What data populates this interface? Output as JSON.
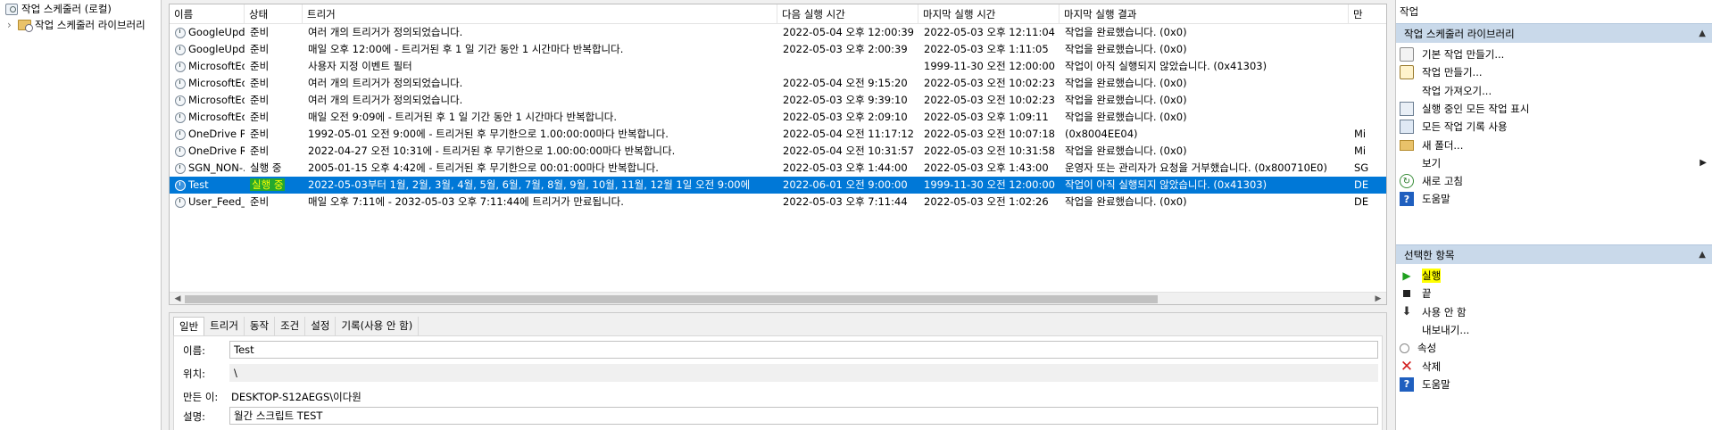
{
  "tree": {
    "root_label": "작업 스케줄러 (로컬)",
    "library_label": "작업 스케줄러 라이브러리"
  },
  "columns": {
    "name": "이름",
    "status": "상태",
    "triggers": "트리거",
    "next_run": "다음 실행 시간",
    "last_run": "마지막 실행 시간",
    "last_result": "마지막 실행 결과",
    "author": "만"
  },
  "tasks": [
    {
      "name": "GoogleUpda...",
      "status": "준비",
      "trigger": "여러 개의 트리거가 정의되었습니다.",
      "next": "2022-05-04 오후 12:00:39",
      "last": "2022-05-03 오후 12:11:04",
      "result": "작업을 완료했습니다. (0x0)",
      "author": ""
    },
    {
      "name": "GoogleUpda...",
      "status": "준비",
      "trigger": "매일 오후 12:00에 - 트리거된 후 1 일 기간 동안 1 시간마다 반복합니다.",
      "next": "2022-05-03 오후 2:00:39",
      "last": "2022-05-03 오후 1:11:05",
      "result": "작업을 완료했습니다. (0x0)",
      "author": ""
    },
    {
      "name": "MicrosoftEd...",
      "status": "준비",
      "trigger": "사용자 지정 이벤트 필터",
      "next": "",
      "last": "1999-11-30 오전 12:00:00",
      "result": "작업이 아직 실행되지 않았습니다. (0x41303)",
      "author": ""
    },
    {
      "name": "MicrosoftEd...",
      "status": "준비",
      "trigger": "여러 개의 트리거가 정의되었습니다.",
      "next": "2022-05-04 오전 9:15:20",
      "last": "2022-05-03 오전 10:02:23",
      "result": "작업을 완료했습니다. (0x0)",
      "author": ""
    },
    {
      "name": "MicrosoftEd...",
      "status": "준비",
      "trigger": "여러 개의 트리거가 정의되었습니다.",
      "next": "2022-05-03 오후 9:39:10",
      "last": "2022-05-03 오전 10:02:23",
      "result": "작업을 완료했습니다. (0x0)",
      "author": ""
    },
    {
      "name": "MicrosoftEd...",
      "status": "준비",
      "trigger": "매일 오전 9:09에 - 트리거된 후 1 일 기간 동안 1 시간마다 반복합니다.",
      "next": "2022-05-03 오후 2:09:10",
      "last": "2022-05-03 오후 1:09:11",
      "result": "작업을 완료했습니다. (0x0)",
      "author": ""
    },
    {
      "name": "OneDrive Pe...",
      "status": "준비",
      "trigger": "1992-05-01 오전 9:00에 - 트리거된 후 무기한으로 1.00:00:00마다 반복합니다.",
      "next": "2022-05-04 오전 11:17:12",
      "last": "2022-05-03 오전 10:07:18",
      "result": "(0x8004EE04)",
      "author": "Mi"
    },
    {
      "name": "OneDrive Re...",
      "status": "준비",
      "trigger": "2022-04-27 오전 10:31에 - 트리거된 후 무기한으로 1.00:00:00마다 반복합니다.",
      "next": "2022-05-04 오전 10:31:57",
      "last": "2022-05-03 오전 10:31:58",
      "result": "작업을 완료했습니다. (0x0)",
      "author": "Mi"
    },
    {
      "name": "SGN_NON-...",
      "status": "실행 중",
      "trigger": "2005-01-15 오후 4:42에 - 트리거된 후 무기한으로 00:01:00마다 반복합니다.",
      "next": "2022-05-03 오후 1:44:00",
      "last": "2022-05-03 오후 1:43:00",
      "result": "운영자 또는 관리자가 요청을 거부했습니다. (0x800710E0)",
      "author": "SG"
    },
    {
      "name": "Test",
      "status": "실행 중",
      "trigger": "2022-05-03부터 1월, 2월, 3월, 4월, 5월, 6월, 7월, 8월, 9월, 10월, 11월, 12월 1일 오전 9:00에",
      "next": "2022-06-01 오전 9:00:00",
      "last": "1999-11-30 오전 12:00:00",
      "result": "작업이 아직 실행되지 않았습니다. (0x41303)",
      "author": "DE"
    },
    {
      "name": "User_Feed_S...",
      "status": "준비",
      "trigger": "매일 오후 7:11에 - 2032-05-03 오후 7:11:44에 트리거가 만료됩니다.",
      "next": "2022-05-03 오후 7:11:44",
      "last": "2022-05-03 오전 1:02:26",
      "result": "작업을 완료했습니다. (0x0)",
      "author": "DE"
    }
  ],
  "detail": {
    "tabs": [
      "일반",
      "트리거",
      "동작",
      "조건",
      "설정",
      "기록(사용 안 함)"
    ],
    "name_label": "이름:",
    "name_value": "Test",
    "location_label": "위치:",
    "location_value": "\\",
    "author_label": "만든 이:",
    "author_value": "DESKTOP-S12AEGS\\이다원",
    "desc_label": "설명:",
    "desc_value": "월간 스크립트 TEST"
  },
  "actions": {
    "title": "작업",
    "section_library": "작업 스케줄러 라이브러리",
    "library_items": [
      {
        "label": "기본 작업 만들기...",
        "icon": "create-basic-task-icon"
      },
      {
        "label": "작업 만들기...",
        "icon": "create-task-icon"
      },
      {
        "label": "작업 가져오기...",
        "icon": ""
      },
      {
        "label": "실행 중인 모든 작업 표시",
        "icon": "running-tasks-icon"
      },
      {
        "label": "모든 작업 기록 사용",
        "icon": "history-icon"
      },
      {
        "label": "새 폴더...",
        "icon": "folder-icon"
      },
      {
        "label": "보기",
        "icon": ""
      },
      {
        "label": "새로 고침",
        "icon": "refresh-icon"
      },
      {
        "label": "도움말",
        "icon": "help-icon"
      }
    ],
    "section_selected": "선택한 항목",
    "selected_items": [
      {
        "label": "실행",
        "icon": "run-icon"
      },
      {
        "label": "끝",
        "icon": "end-icon"
      },
      {
        "label": "사용 안 함",
        "icon": "disable-icon"
      },
      {
        "label": "내보내기...",
        "icon": ""
      },
      {
        "label": "속성",
        "icon": "properties-icon"
      },
      {
        "label": "삭제",
        "icon": "delete-icon"
      },
      {
        "label": "도움말",
        "icon": "help-icon"
      }
    ],
    "submenu_arrow": "▶",
    "collapse_caret": "▲"
  },
  "colors": {
    "selection": "#0078d7",
    "status_highlight_bg": "#23a82e",
    "status_highlight_fg": "#ffff00",
    "action_highlight": "#ffff00",
    "section_header": "#c9d9ea"
  }
}
